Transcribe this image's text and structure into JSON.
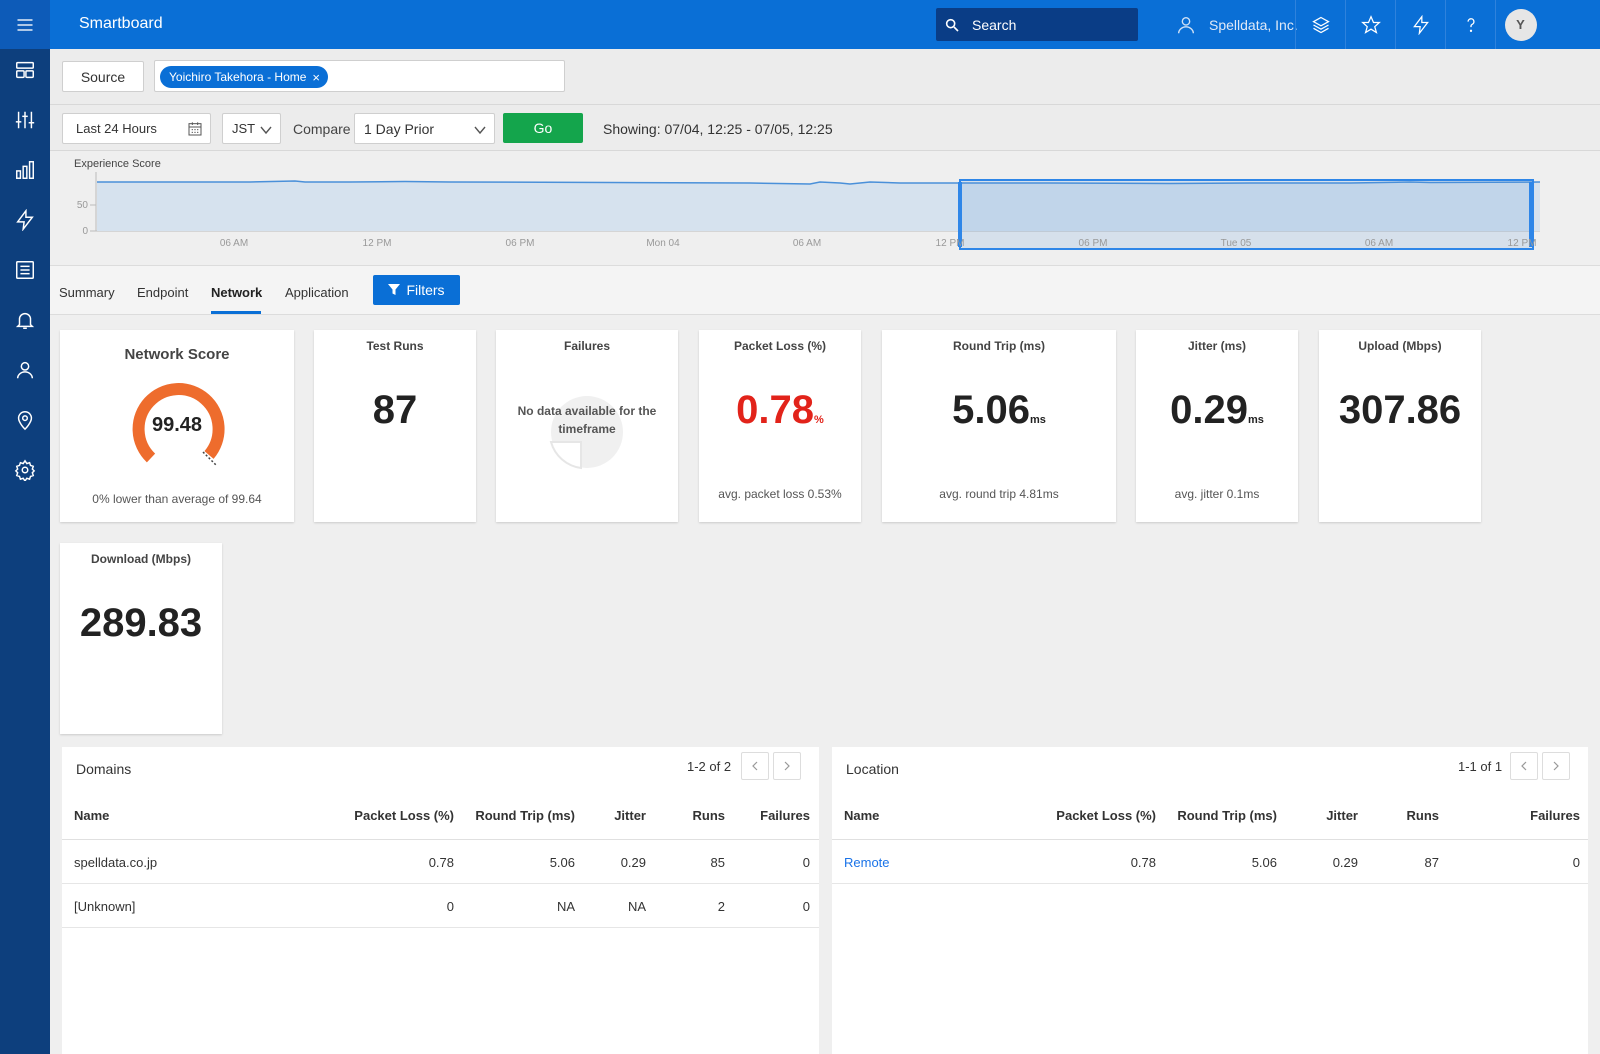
{
  "header": {
    "app_title": "Smartboard",
    "search_placeholder": "Search",
    "org_name": "Spelldata, Inc.",
    "avatar_initial": "Y",
    "accent_color": "#0a6fd6",
    "sidebar_color": "#0d3f7d"
  },
  "sidebar": {
    "items": [
      {
        "icon": "dashboard-icon"
      },
      {
        "icon": "sliders-icon"
      },
      {
        "icon": "bar-chart-icon"
      },
      {
        "icon": "lightning-icon"
      },
      {
        "icon": "list-icon"
      },
      {
        "icon": "bell-icon"
      },
      {
        "icon": "user-icon"
      },
      {
        "icon": "location-pin-icon"
      },
      {
        "icon": "gear-icon"
      }
    ]
  },
  "source": {
    "button_label": "Source",
    "chip_label": "Yoichiro Takehora - Home",
    "chip_close": "×"
  },
  "controls": {
    "range_value": "Last 24 Hours",
    "timezone_value": "JST",
    "compare_label": "Compare",
    "compare_value": "1 Day Prior",
    "go_label": "Go",
    "showing_text": "Showing: 07/04, 12:25 - 07/05, 12:25"
  },
  "experience_chart": {
    "label": "Experience Score",
    "y_ticks": [
      "50",
      "0"
    ],
    "x_ticks": [
      "06 AM",
      "12 PM",
      "06 PM",
      "Mon 04",
      "06 AM",
      "12 PM",
      "06 PM",
      "Tue 05",
      "06 AM",
      "12 PM"
    ],
    "series_color": "#4a90d9",
    "selected_range": [
      "07/04 12:25",
      "07/05 12:25"
    ]
  },
  "tabs": {
    "items": [
      "Summary",
      "Endpoint",
      "Network",
      "Application"
    ],
    "active": "Network",
    "filters_label": "Filters"
  },
  "cards": {
    "network_score": {
      "title": "Network Score",
      "value": "99.48",
      "sub": "0% lower than average of 99.64",
      "gauge_color": "#ee6c2d"
    },
    "test_runs": {
      "title": "Test Runs",
      "value": "87"
    },
    "failures": {
      "title": "Failures",
      "no_data": "No data available for the timeframe"
    },
    "packet_loss": {
      "title": "Packet Loss (%)",
      "value": "0.78",
      "unit": "%",
      "sub": "avg. packet loss 0.53%",
      "value_color": "#e2231a"
    },
    "round_trip": {
      "title": "Round Trip (ms)",
      "value": "5.06",
      "unit": "ms",
      "sub": "avg. round trip 4.81ms"
    },
    "jitter": {
      "title": "Jitter (ms)",
      "value": "0.29",
      "unit": "ms",
      "sub": "avg. jitter 0.1ms"
    },
    "upload": {
      "title": "Upload (Mbps)",
      "value": "307.86"
    },
    "download": {
      "title": "Download (Mbps)",
      "value": "289.83"
    }
  },
  "domains": {
    "title": "Domains",
    "pager": "1-2 of 2",
    "columns": [
      "Name",
      "Packet Loss (%)",
      "Round Trip (ms)",
      "Jitter",
      "Runs",
      "Failures"
    ],
    "rows": [
      [
        "spelldata.co.jp",
        "0.78",
        "5.06",
        "0.29",
        "85",
        "0"
      ],
      [
        "[Unknown]",
        "0",
        "NA",
        "NA",
        "2",
        "0"
      ]
    ]
  },
  "location": {
    "title": "Location",
    "pager": "1-1 of 1",
    "columns": [
      "Name",
      "Packet Loss (%)",
      "Round Trip (ms)",
      "Jitter",
      "Runs",
      "Failures"
    ],
    "rows": [
      [
        "Remote",
        "0.78",
        "5.06",
        "0.29",
        "87",
        "0"
      ]
    ]
  }
}
